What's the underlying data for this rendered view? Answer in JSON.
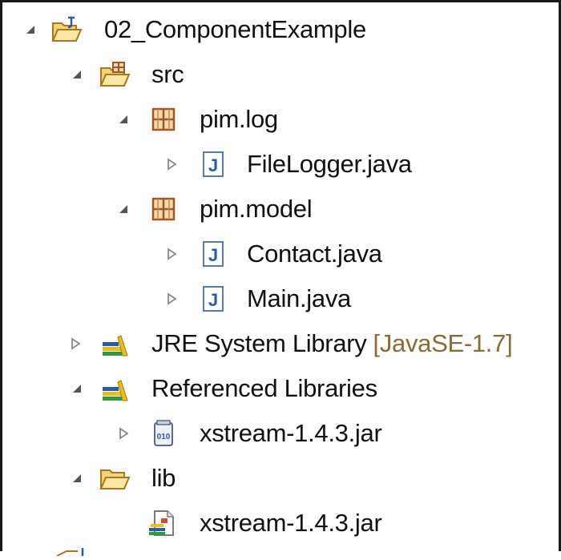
{
  "tree": {
    "project": {
      "label": "02_ComponentExample",
      "icon": "project-folder-icon",
      "expanded": true
    },
    "src": {
      "label": "src",
      "icon": "source-folder-icon",
      "expanded": true
    },
    "pkg_log": {
      "label": "pim.log",
      "icon": "package-icon",
      "expanded": true
    },
    "file_logger": {
      "label": "FileLogger.java",
      "icon": "java-file-icon",
      "expanded": false
    },
    "pkg_model": {
      "label": "pim.model",
      "icon": "package-icon",
      "expanded": true
    },
    "contact": {
      "label": "Contact.java",
      "icon": "java-file-icon",
      "expanded": false
    },
    "main": {
      "label": "Main.java",
      "icon": "java-file-icon",
      "expanded": false
    },
    "jre": {
      "label": "JRE System Library",
      "decoration": "[JavaSE-1.7]",
      "icon": "library-icon",
      "expanded": false
    },
    "ref_libs": {
      "label": "Referenced Libraries",
      "icon": "library-icon",
      "expanded": true
    },
    "xstream_ref": {
      "label": "xstream-1.4.3.jar",
      "icon": "jar-icon",
      "expanded": false
    },
    "lib": {
      "label": "lib",
      "icon": "folder-icon",
      "expanded": true
    },
    "xstream_lib": {
      "label": "xstream-1.4.3.jar",
      "icon": "jar-file-icon"
    }
  },
  "colors": {
    "text": "#111111",
    "decoration": "#8a6a38",
    "folder": "#e9b84a",
    "package": "#9a5a2a",
    "java_file": "#2d5aa8",
    "library_green": "#2f9a3a",
    "library_yellow": "#e7c020"
  }
}
